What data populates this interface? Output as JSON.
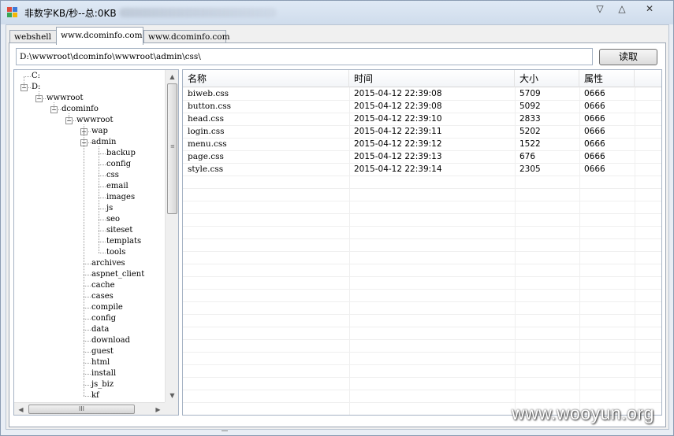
{
  "window": {
    "title": "非数字KB/秒--总:0KB",
    "controls": {
      "minimize": "▽",
      "maximize": "△",
      "close": "✕"
    }
  },
  "tabs": [
    {
      "label": "webshell",
      "active": false
    },
    {
      "label": "www.dcominfo.com",
      "active": true
    },
    {
      "label": "www.dcominfo.com",
      "active": false
    }
  ],
  "path": {
    "value": "D:\\wwwroot\\dcominfo\\wwwroot\\admin\\css\\"
  },
  "read_button": {
    "label": "读取"
  },
  "tree": {
    "nodes": [
      {
        "label": "C:",
        "depth": 0,
        "expander": "none"
      },
      {
        "label": "D:",
        "depth": 0,
        "expander": "minus"
      },
      {
        "label": "wwwroot",
        "depth": 1,
        "expander": "minus"
      },
      {
        "label": "dcominfo",
        "depth": 2,
        "expander": "minus"
      },
      {
        "label": "wwwroot",
        "depth": 3,
        "expander": "minus"
      },
      {
        "label": "wap",
        "depth": 4,
        "expander": "plus"
      },
      {
        "label": "admin",
        "depth": 4,
        "expander": "minus"
      },
      {
        "label": "backup",
        "depth": 5,
        "expander": "none"
      },
      {
        "label": "config",
        "depth": 5,
        "expander": "none"
      },
      {
        "label": "css",
        "depth": 5,
        "expander": "none"
      },
      {
        "label": "email",
        "depth": 5,
        "expander": "none"
      },
      {
        "label": "images",
        "depth": 5,
        "expander": "none"
      },
      {
        "label": "js",
        "depth": 5,
        "expander": "none"
      },
      {
        "label": "seo",
        "depth": 5,
        "expander": "none"
      },
      {
        "label": "siteset",
        "depth": 5,
        "expander": "none"
      },
      {
        "label": "templats",
        "depth": 5,
        "expander": "none"
      },
      {
        "label": "tools",
        "depth": 5,
        "expander": "none"
      },
      {
        "label": "archives",
        "depth": 4,
        "expander": "none"
      },
      {
        "label": "aspnet_client",
        "depth": 4,
        "expander": "none"
      },
      {
        "label": "cache",
        "depth": 4,
        "expander": "none"
      },
      {
        "label": "cases",
        "depth": 4,
        "expander": "none"
      },
      {
        "label": "compile",
        "depth": 4,
        "expander": "none"
      },
      {
        "label": "config",
        "depth": 4,
        "expander": "none"
      },
      {
        "label": "data",
        "depth": 4,
        "expander": "none"
      },
      {
        "label": "download",
        "depth": 4,
        "expander": "none"
      },
      {
        "label": "guest",
        "depth": 4,
        "expander": "none"
      },
      {
        "label": "html",
        "depth": 4,
        "expander": "none"
      },
      {
        "label": "install",
        "depth": 4,
        "expander": "none"
      },
      {
        "label": "js_biz",
        "depth": 4,
        "expander": "none"
      },
      {
        "label": "kf",
        "depth": 4,
        "expander": "none"
      }
    ],
    "scroll_grip": "≡",
    "hscroll_grip": "III",
    "arrows": {
      "up": "▲",
      "down": "▼",
      "left": "◀",
      "right": "▶"
    }
  },
  "file_list": {
    "columns": [
      "名称",
      "时间",
      "大小",
      "属性"
    ],
    "rows": [
      {
        "name": "biweb.css",
        "time": "2015-04-12 22:39:08",
        "size": "5709",
        "attr": "0666"
      },
      {
        "name": "button.css",
        "time": "2015-04-12 22:39:08",
        "size": "5092",
        "attr": "0666"
      },
      {
        "name": "head.css",
        "time": "2015-04-12 22:39:10",
        "size": "2833",
        "attr": "0666"
      },
      {
        "name": "login.css",
        "time": "2015-04-12 22:39:11",
        "size": "5202",
        "attr": "0666"
      },
      {
        "name": "menu.css",
        "time": "2015-04-12 22:39:12",
        "size": "1522",
        "attr": "0666"
      },
      {
        "name": "page.css",
        "time": "2015-04-12 22:39:13",
        "size": "676",
        "attr": "0666"
      },
      {
        "name": "style.css",
        "time": "2015-04-12 22:39:14",
        "size": "2305",
        "attr": "0666"
      }
    ]
  },
  "watermark": "www.wooyun.org"
}
